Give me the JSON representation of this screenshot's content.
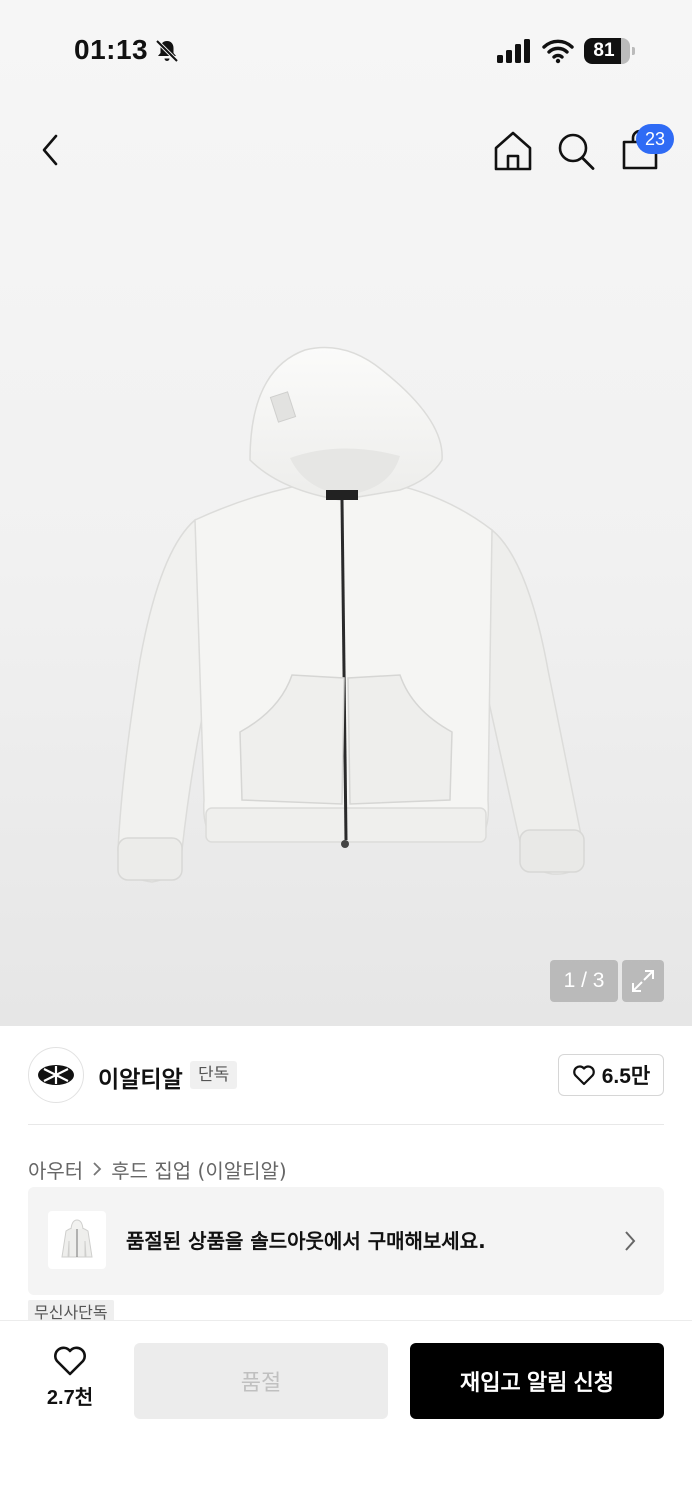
{
  "status_bar": {
    "time": "01:13",
    "battery": "81",
    "battery_level": 0.81,
    "icons": [
      "bell-off-icon",
      "signal-icon",
      "wifi-icon",
      "battery-icon"
    ]
  },
  "nav": {
    "icons": [
      "back-arrow-icon",
      "home-icon",
      "search-icon",
      "shopping-bag-icon"
    ],
    "cart_count": "23"
  },
  "gallery": {
    "pager": "1 / 3"
  },
  "brand": {
    "name": "이알티알",
    "tag": "단독",
    "likes": "6.5만"
  },
  "breadcrumb": {
    "category": "아우터",
    "subcategory": "후드 집업 (이알티알)"
  },
  "soldout_banner": {
    "text": "품절된 상품을 솔드아웃에서 구매해보세요."
  },
  "exclusive_tag": "무신사단독",
  "bottom_bar": {
    "wish_count": "2.7천",
    "soldout_label": "품절",
    "restock_label": "재입고 알림 신청"
  },
  "colors": {
    "badge": "#2f6bf5",
    "primary_button": "#000000",
    "disabled_button": "#ececec"
  }
}
